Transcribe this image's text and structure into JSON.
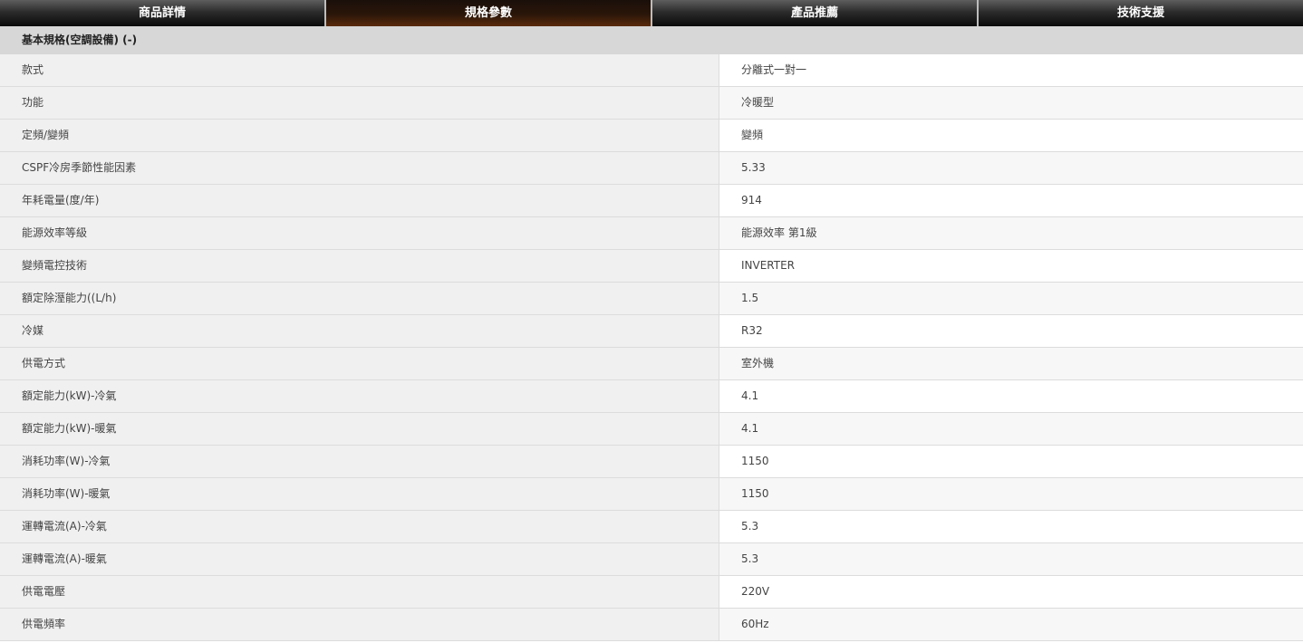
{
  "tabs": [
    {
      "label": "商品詳情",
      "active": false
    },
    {
      "label": "規格參數",
      "active": true
    },
    {
      "label": "產品推薦",
      "active": false
    },
    {
      "label": "技術支援",
      "active": false
    }
  ],
  "section": {
    "title": "基本規格(空調設備) (-)"
  },
  "specs": [
    {
      "label": "款式",
      "value": "分離式一對一"
    },
    {
      "label": "功能",
      "value": "冷暖型"
    },
    {
      "label": "定頻/變頻",
      "value": "變頻"
    },
    {
      "label": "CSPF冷房季節性能因素",
      "value": "5.33"
    },
    {
      "label": "年耗電量(度/年)",
      "value": "914"
    },
    {
      "label": "能源效率等級",
      "value": "能源效率 第1級"
    },
    {
      "label": "變頻電控技術",
      "value": "INVERTER"
    },
    {
      "label": "額定除溼能力((L/h)",
      "value": "1.5"
    },
    {
      "label": "冷媒",
      "value": "R32"
    },
    {
      "label": "供電方式",
      "value": "室外機"
    },
    {
      "label": "額定能力(kW)-冷氣",
      "value": "4.1"
    },
    {
      "label": "額定能力(kW)-暖氣",
      "value": "4.1"
    },
    {
      "label": "消耗功率(W)-冷氣",
      "value": "1150"
    },
    {
      "label": "消耗功率(W)-暖氣",
      "value": "1150"
    },
    {
      "label": "運轉電流(A)-冷氣",
      "value": "5.3"
    },
    {
      "label": "運轉電流(A)-暖氣",
      "value": "5.3"
    },
    {
      "label": "供電電壓",
      "value": "220V"
    },
    {
      "label": "供電頻率",
      "value": "60Hz"
    }
  ]
}
